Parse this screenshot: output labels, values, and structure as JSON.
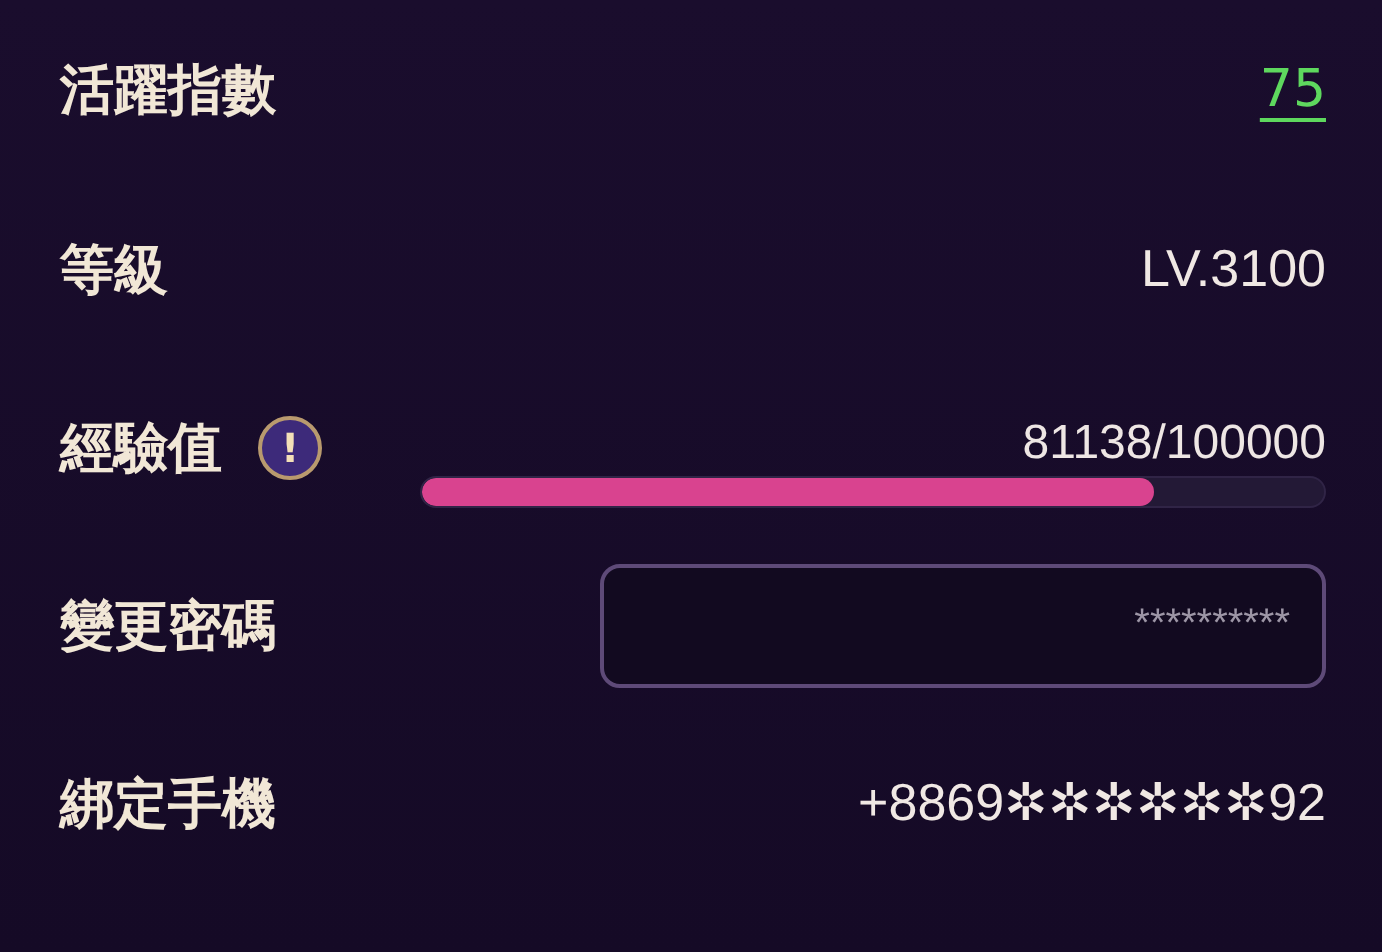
{
  "rows": [
    {
      "kind": "link",
      "label": "活躍指數",
      "value": "75"
    },
    {
      "kind": "text",
      "label": "等級",
      "value": "LV.3100"
    },
    {
      "kind": "progress",
      "label": "經驗值",
      "info_icon": "!",
      "reading": "81138/100000",
      "level": 0.81138
    },
    {
      "kind": "field",
      "label": "變更密碼",
      "placeholder": "**********"
    },
    {
      "kind": "text",
      "label": "綁定手機",
      "value": "+8869✲✲✲✲✲✲92"
    }
  ]
}
